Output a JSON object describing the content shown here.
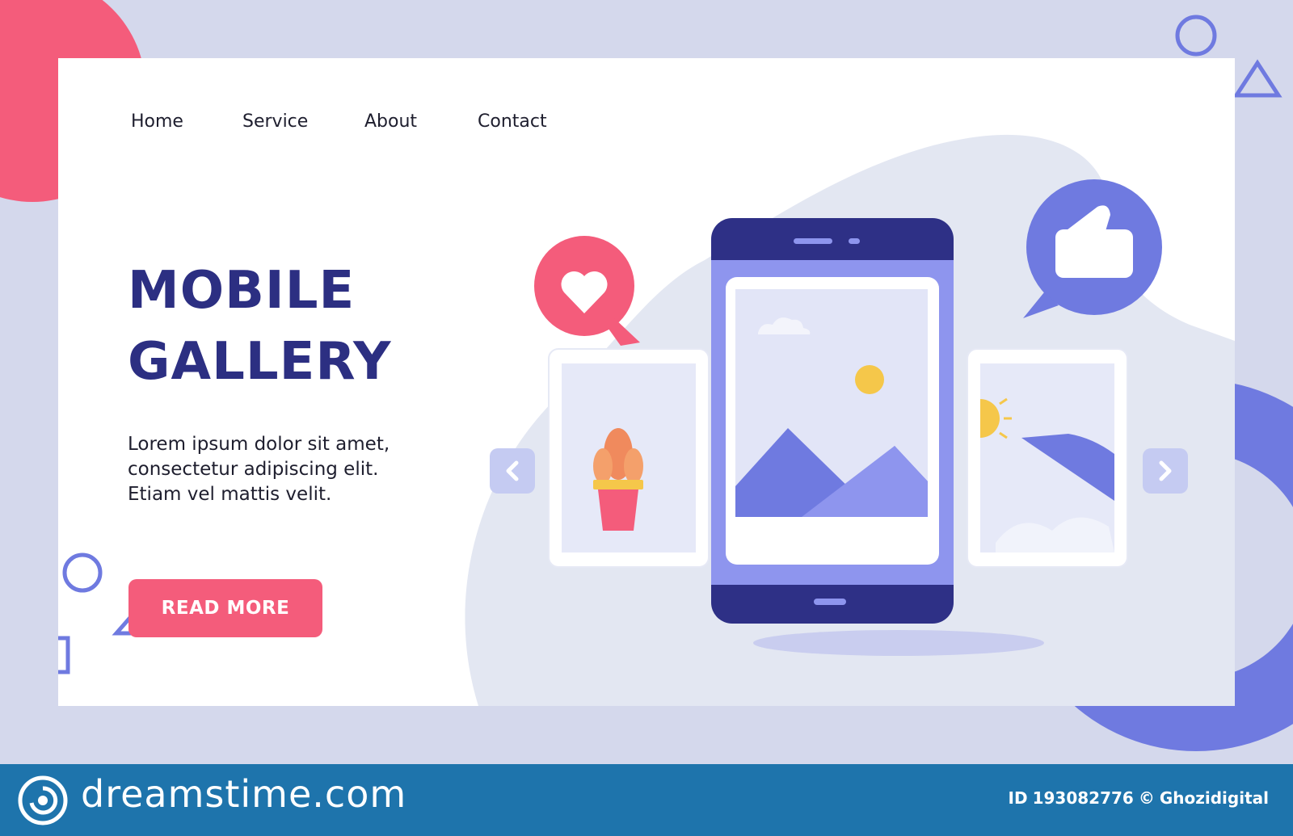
{
  "colors": {
    "page_background": "#d4d8ec",
    "card_background": "#ffffff",
    "accent_pink": "#f45c7b",
    "accent_indigo": "#2c2f82",
    "phone_body": "#2e3086",
    "phone_screen": "#8e95ee",
    "footer_background": "#1e74ac"
  },
  "nav": {
    "items": [
      "Home",
      "Service",
      "About",
      "Contact"
    ]
  },
  "hero": {
    "title_lines": [
      "MOBILE",
      "GALLERY"
    ],
    "description_lines": [
      "Lorem ipsum dolor sit amet,",
      "consectetur adipiscing elit.",
      "Etiam vel mattis velit."
    ],
    "cta_label": "READ MORE"
  },
  "gallery": {
    "prev_icon": "chevron-left-icon",
    "next_icon": "chevron-right-icon",
    "left_card_icon": "potted-cactus-icon",
    "center_image_icon": "mountain-landscape-icon",
    "right_card_icon": "airplane-in-sky-icon",
    "heart_bubble_icon": "heart-icon",
    "like_bubble_icon": "thumbs-up-icon"
  },
  "footer": {
    "brand": "dreamstime.com",
    "id_label": "ID",
    "id_number": "193082776",
    "copyright_symbol": "©",
    "author": "Ghozidigital"
  }
}
